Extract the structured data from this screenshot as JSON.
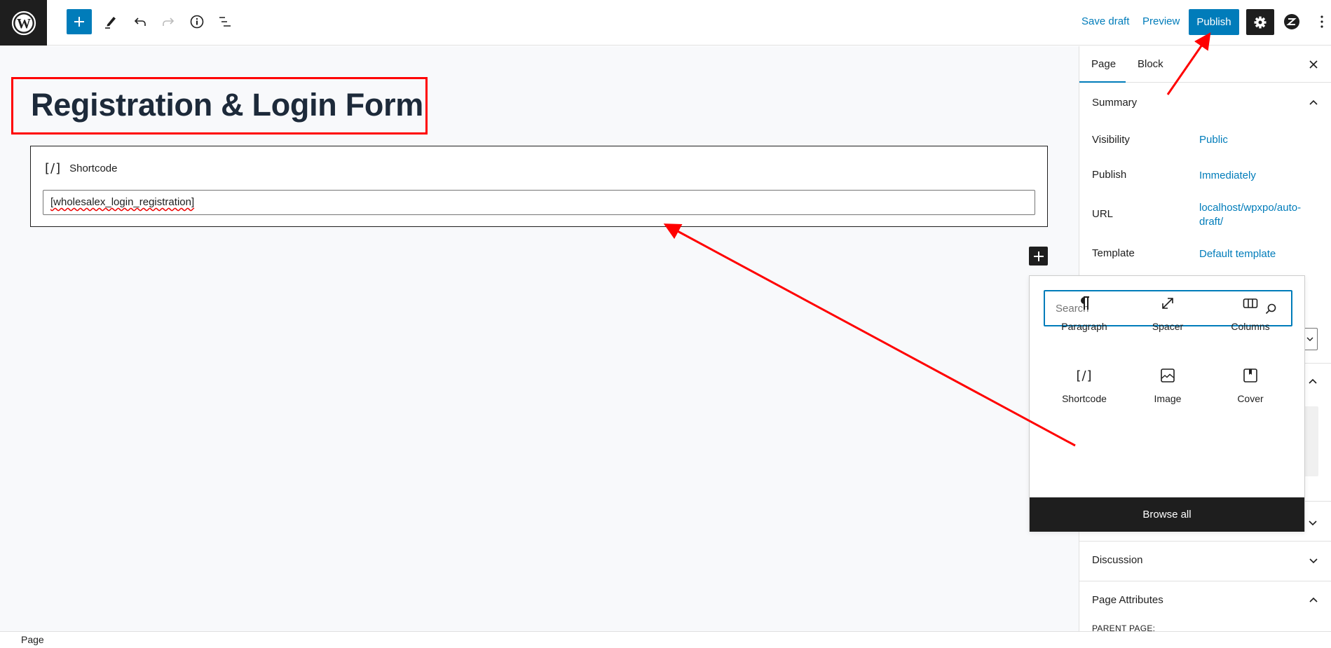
{
  "header": {
    "logo": "wordpress-logo",
    "toolbar": {
      "add_block": "Toggle block inserter",
      "tools": "Tools",
      "undo": "Undo",
      "redo": "Redo",
      "details": "Details",
      "list_view": "Document Overview"
    },
    "save_draft_label": "Save draft",
    "preview_label": "Preview",
    "publish_label": "Publish",
    "settings": "Settings",
    "plugin": "plugin-icon",
    "options": "Options"
  },
  "editor": {
    "title": "Registration & Login Form",
    "blocks": [
      {
        "type": "shortcode",
        "icon_glyph": "[/]",
        "label": "Shortcode",
        "value": "[wholesalex_login_registration]"
      }
    ]
  },
  "sidebar": {
    "tabs": [
      {
        "label": "Page",
        "active": true
      },
      {
        "label": "Block",
        "active": false
      }
    ],
    "summary": {
      "title": "Summary",
      "rows": [
        {
          "label": "Visibility",
          "value": "Public"
        },
        {
          "label": "Publish",
          "value": "Immediately"
        },
        {
          "label": "URL",
          "value": "localhost/wpxpo/auto-draft/"
        },
        {
          "label": "Template",
          "value": "Default template"
        }
      ]
    },
    "panels": [
      {
        "title": "Discussion",
        "expanded": false
      },
      {
        "title": "Page Attributes",
        "expanded": true
      }
    ],
    "parent_page_label": "PARENT PAGE:"
  },
  "inserter": {
    "search_placeholder": "Search",
    "search_value": "",
    "blocks": [
      {
        "label": "Paragraph",
        "icon": "paragraph-icon"
      },
      {
        "label": "Spacer",
        "icon": "spacer-icon"
      },
      {
        "label": "Columns",
        "icon": "columns-icon"
      },
      {
        "label": "Shortcode",
        "icon": "shortcode-icon"
      },
      {
        "label": "Image",
        "icon": "image-icon"
      },
      {
        "label": "Cover",
        "icon": "cover-icon"
      }
    ],
    "browse_all_label": "Browse all"
  },
  "footer": {
    "breadcrumb": "Page"
  },
  "colors": {
    "accent": "#007cba",
    "dark": "#1e1e1e",
    "annotation": "#ff0000"
  }
}
